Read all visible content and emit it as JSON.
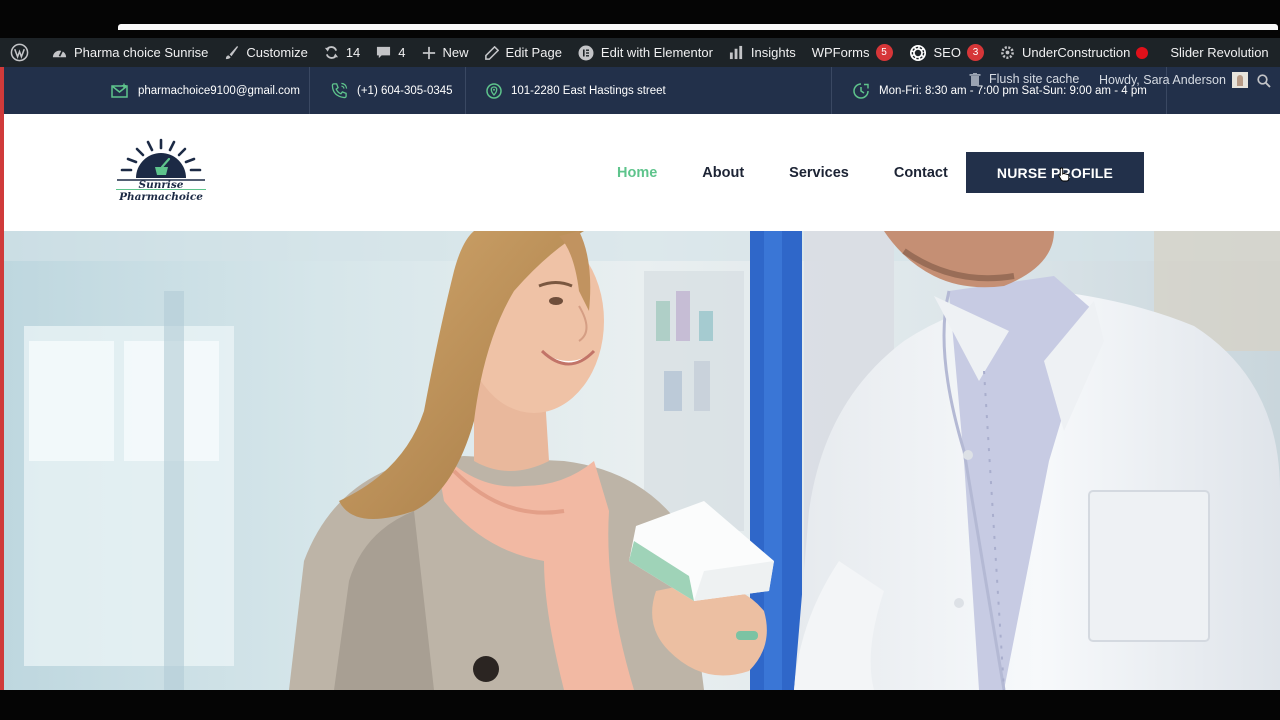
{
  "admin_bar": {
    "site_name": "Pharma choice Sunrise",
    "customize": "Customize",
    "updates_count": "14",
    "comments_count": "4",
    "new": "New",
    "edit_page": "Edit Page",
    "edit_elementor": "Edit with Elementor",
    "insights": "Insights",
    "wpforms": "WPForms",
    "wpforms_badge": "5",
    "seo": "SEO",
    "seo_badge": "3",
    "under_construction": "UnderConstruction",
    "slider_revolution": "Slider Revolution",
    "flush_cache": "Flush site cache",
    "howdy": "Howdy, Sara Anderson"
  },
  "topbar": {
    "email": "pharmachoice9100@gmail.com",
    "phone": "(+1) 604-305-0345",
    "address": "101-2280 East Hastings street",
    "hours": "Mon-Fri: 8:30 am - 7:00 pm Sat-Sun: 9:00 am - 4 pm"
  },
  "logo": {
    "line1": "Sunrise",
    "line2": "Pharmachoice"
  },
  "nav": {
    "home": "Home",
    "about": "About",
    "services": "Services",
    "contact": "Contact",
    "cta": "NURSE PROFILE"
  },
  "colors": {
    "admin_bar_bg": "#1d2327",
    "topbar_bg": "#22304a",
    "accent_green": "#5ec48c",
    "cta_bg": "#22304a",
    "badge_red": "#d63638"
  }
}
